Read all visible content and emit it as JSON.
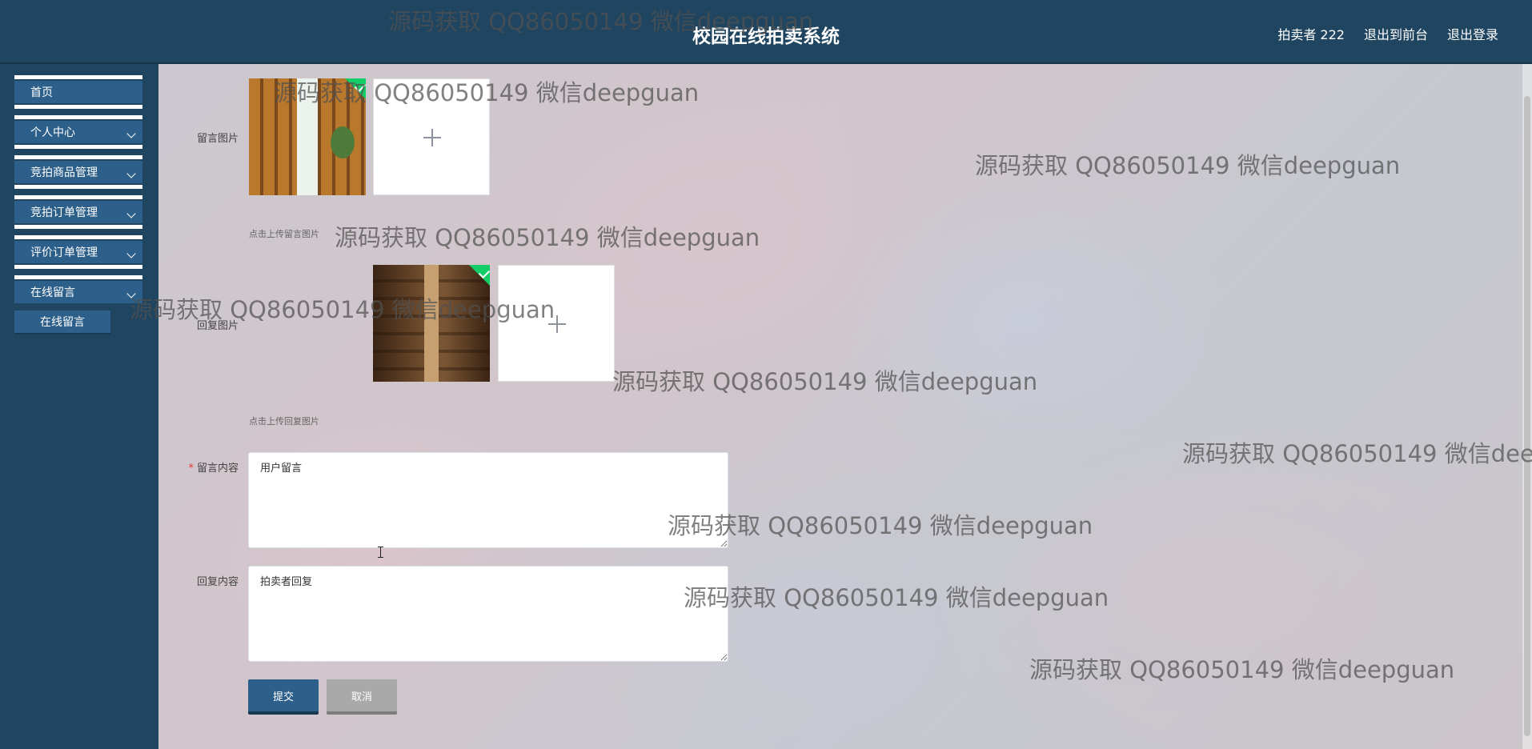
{
  "header": {
    "title": "校园在线拍卖系统",
    "user": "拍卖者 222",
    "to_front": "退出到前台",
    "logout": "退出登录"
  },
  "sidebar": {
    "items": [
      {
        "label": "首页"
      },
      {
        "label": "个人中心"
      },
      {
        "label": "竞拍商品管理"
      },
      {
        "label": "竞拍订单管理"
      },
      {
        "label": "评价订单管理"
      },
      {
        "label": "在线留言"
      }
    ],
    "submenu": {
      "label": "在线留言"
    }
  },
  "form": {
    "message_image_label": "留言图片",
    "message_image_hint": "点击上传留言图片",
    "reply_image_label": "回复图片",
    "reply_image_hint": "点击上传回复图片",
    "message_content_label": "留言内容",
    "message_content_value": "用户留言",
    "reply_content_label": "回复内容",
    "reply_content_value": "拍卖者回复",
    "submit": "提交",
    "cancel": "取消"
  },
  "watermark": "源码获取 QQ86050149 微信deepguan"
}
